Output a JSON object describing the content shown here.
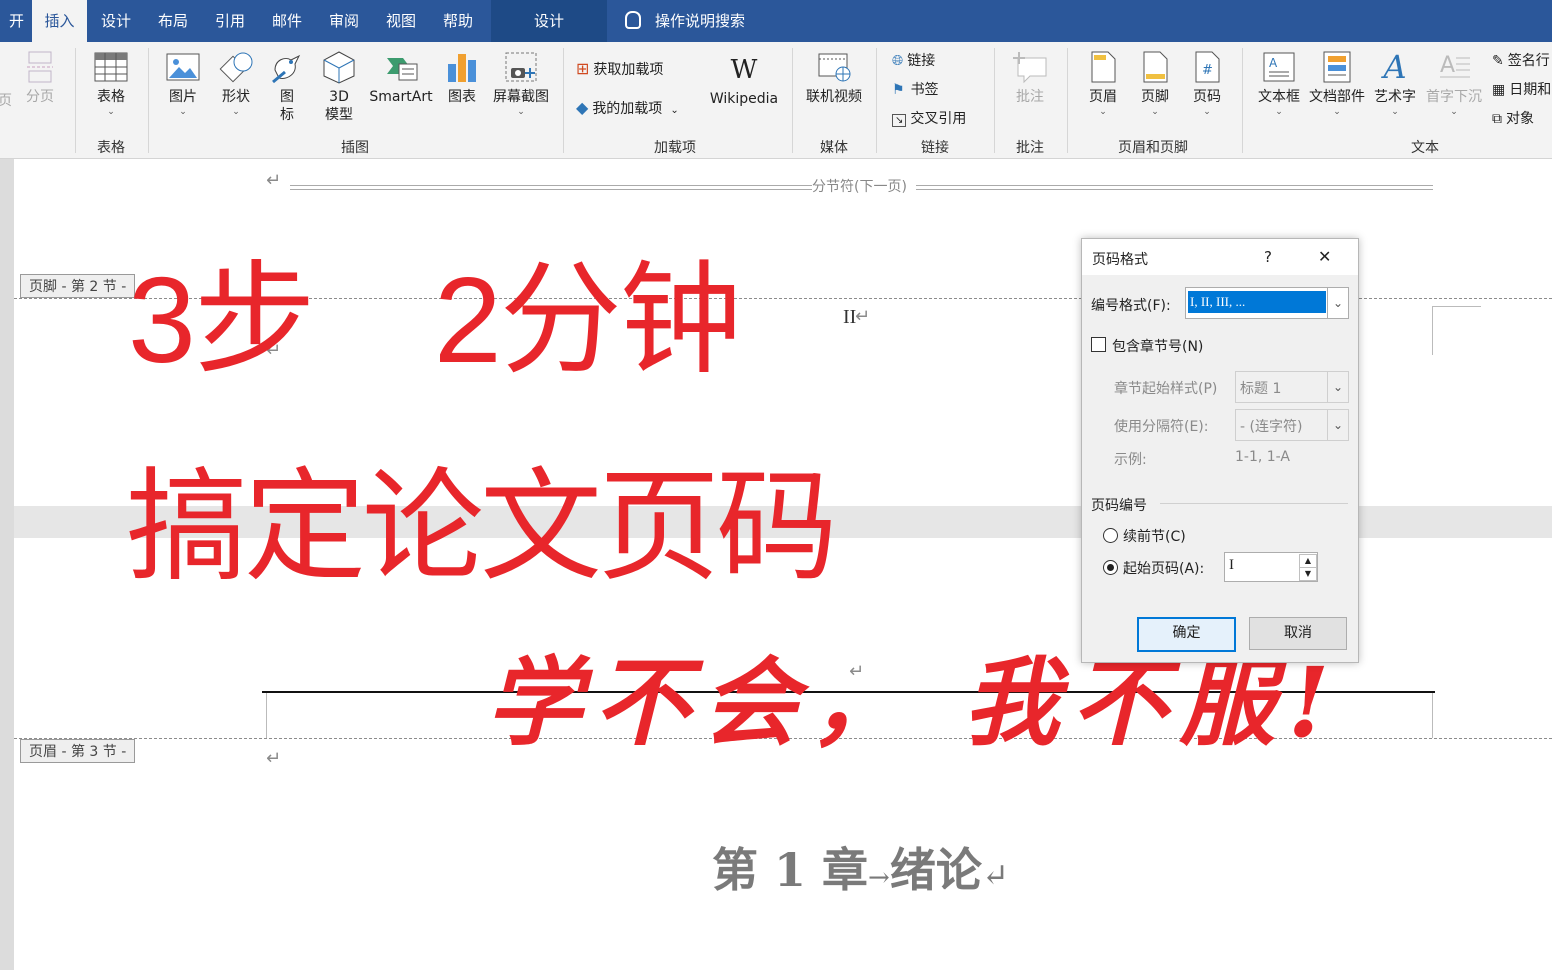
{
  "tabs": {
    "start": "开始",
    "insert": "插入",
    "design": "设计",
    "layout": "布局",
    "references": "引用",
    "mailings": "邮件",
    "review": "审阅",
    "view": "视图",
    "help": "帮助",
    "context_design": "设计",
    "tell_me": "操作说明搜索"
  },
  "ribbon": {
    "pages": {
      "page_break": "分页",
      "label_partial": "页"
    },
    "tables": {
      "table": "表格",
      "group": "表格"
    },
    "illustrations": {
      "picture": "图片",
      "shapes": "形状",
      "icons": "图\n标",
      "model3d_1": "3D",
      "model3d_2": "模型",
      "smartart": "SmartArt",
      "chart": "图表",
      "screenshot": "屏幕截图",
      "group": "插图"
    },
    "addins": {
      "get": "获取加载项",
      "mine": "我的加载项",
      "wikipedia": "Wikipedia",
      "group": "加载项"
    },
    "media": {
      "online_video": "联机视频",
      "group": "媒体"
    },
    "links": {
      "link": "链接",
      "bookmark": "书签",
      "crossref": "交叉引用",
      "group": "链接"
    },
    "comments": {
      "comment": "批注",
      "group": "批注"
    },
    "header_footer": {
      "header": "页眉",
      "footer": "页脚",
      "page_number": "页码",
      "group": "页眉和页脚"
    },
    "text": {
      "textbox": "文本框",
      "quickparts": "文档部件",
      "wordart": "艺术字",
      "dropcap": "首字下沉",
      "signature": "签名行",
      "datetime": "日期和",
      "object": "对象",
      "group": "文本"
    }
  },
  "document": {
    "section_break": "分节符(下一页)",
    "footer_tag": "页脚 - 第 2 节 -",
    "header_tag": "页眉 - 第 3 节 -",
    "footer_text": "II",
    "heading": {
      "part1": "第 1 章",
      "part2": "绪论"
    },
    "para_mark": "↵"
  },
  "overlay": {
    "line1": "3步　2分钟",
    "line2": "搞定论文页码",
    "line3": "学不会，  我不服!"
  },
  "dialog": {
    "title": "页码格式",
    "help": "?",
    "close": "✕",
    "format_label": "编号格式(F):",
    "format_value": "I, II, III, ...",
    "include_chapter": "包含章节号(N)",
    "chapter_style_label": "章节起始样式(P)",
    "chapter_style_value": "标题 1",
    "separator_label": "使用分隔符(E):",
    "separator_value": "-  (连字符)",
    "example_label": "示例:",
    "example_value": "1-1, 1-A",
    "numbering_section": "页码编号",
    "continue": "续前节(C)",
    "start_at": "起始页码(A):",
    "start_value": "I",
    "ok": "确定",
    "cancel": "取消"
  }
}
